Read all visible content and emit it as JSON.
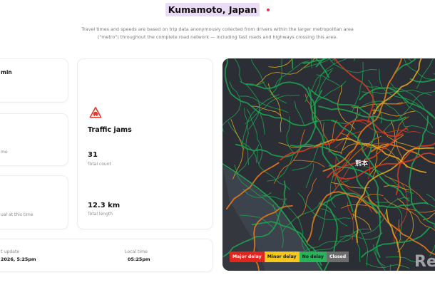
{
  "header": {
    "city": "Kumamoto, Japan",
    "description_line1": "Travel times and speeds are based on trip data anonymously collected from drivers within the larger metropolitan area",
    "description_line2": "(\"metro\") throughout the complete road network — including fast roads and highways crossing this area.",
    "live_dot_color": "#e7305a"
  },
  "cards": {
    "top_left_fragment": "min",
    "mid_left_fragment": "me",
    "bottom_left_fragment": "ual at this time"
  },
  "traffic_jams": {
    "title": "Traffic jams",
    "icon": "traffic-jam-icon",
    "icon_color": "#e23a2a",
    "count": "31",
    "count_label": "Total count",
    "length": "12.3 km",
    "length_label": "Total length"
  },
  "bottom_bar": {
    "last_update_label": "t update",
    "last_update_value": "2026, 5:25pm",
    "local_time_label": "Local time",
    "local_time_value": "05:25pm"
  },
  "map": {
    "city_label": "熊本",
    "watermark": "Res",
    "legend": [
      {
        "label": "Major delay",
        "bg": "#e0261d",
        "fg": "#ffffff"
      },
      {
        "label": "Minor delay",
        "bg": "#f6c81c",
        "fg": "#1a1a1a"
      },
      {
        "label": "No delay",
        "bg": "#27b45a",
        "fg": "#1a1a1a"
      },
      {
        "label": "Closed",
        "bg": "#6d6d6d",
        "fg": "#ffffff"
      }
    ]
  }
}
